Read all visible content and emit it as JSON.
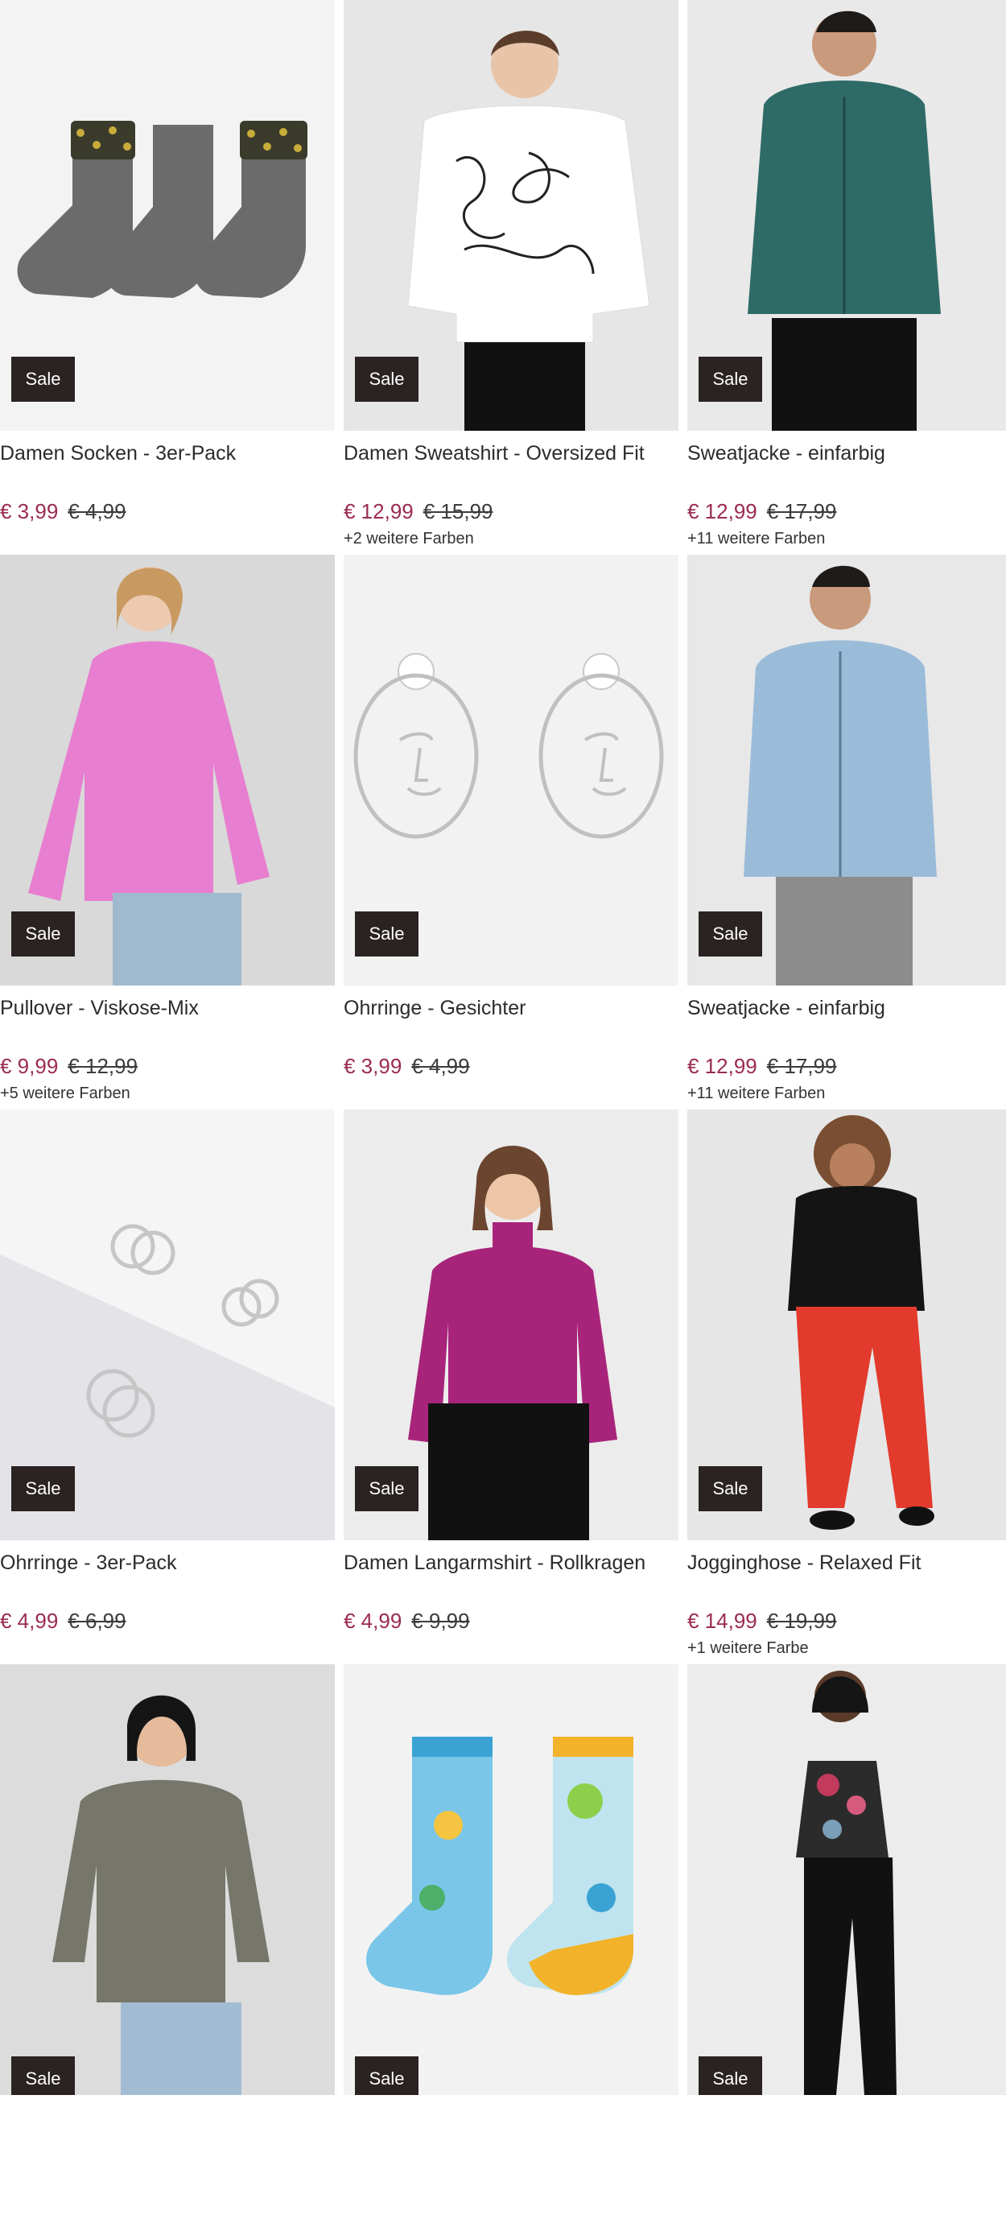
{
  "badge_label": "Sale",
  "colors": {
    "price_accent": "#9b2c4e",
    "badge_bg": "#2a2322"
  },
  "products": [
    {
      "name": "Damen Socken - 3er-Pack",
      "price": "€ 3,99",
      "old_price": "€ 4,99",
      "more_colors": "",
      "image": "grey-socks-leopard"
    },
    {
      "name": "Damen Sweatshirt - Oversized Fit",
      "price": "€ 12,99",
      "old_price": "€ 15,99",
      "more_colors": "+2 weitere Farben",
      "image": "white-line-art-sweatshirt"
    },
    {
      "name": "Sweatjacke - einfarbig",
      "price": "€ 12,99",
      "old_price": "€ 17,99",
      "more_colors": "+11 weitere Farben",
      "image": "green-zip-hoodie"
    },
    {
      "name": "Pullover - Viskose-Mix",
      "price": "€ 9,99",
      "old_price": "€ 12,99",
      "more_colors": "+5 weitere Farben",
      "image": "pink-pullover"
    },
    {
      "name": "Ohrringe - Gesichter",
      "price": "€ 3,99",
      "old_price": "€ 4,99",
      "more_colors": "",
      "image": "face-earrings"
    },
    {
      "name": "Sweatjacke - einfarbig",
      "price": "€ 12,99",
      "old_price": "€ 17,99",
      "more_colors": "+11 weitere Farben",
      "image": "light-blue-zip-hoodie"
    },
    {
      "name": "Ohrringe - 3er-Pack",
      "price": "€ 4,99",
      "old_price": "€ 6,99",
      "more_colors": "",
      "image": "silver-hoop-earrings"
    },
    {
      "name": "Damen Langarmshirt - Rollkragen",
      "price": "€ 4,99",
      "old_price": "€ 9,99",
      "more_colors": "",
      "image": "magenta-turtleneck"
    },
    {
      "name": "Jogginghose - Relaxed Fit",
      "price": "€ 14,99",
      "old_price": "€ 19,99",
      "more_colors": "+1 weitere Farbe",
      "image": "red-jogging-pants"
    },
    {
      "name": "",
      "price": "",
      "old_price": "",
      "more_colors": "",
      "image": "olive-sweater"
    },
    {
      "name": "",
      "price": "",
      "old_price": "",
      "more_colors": "",
      "image": "monster-kids-socks"
    },
    {
      "name": "",
      "price": "",
      "old_price": "",
      "more_colors": "",
      "image": "floral-bandeau-top"
    }
  ]
}
